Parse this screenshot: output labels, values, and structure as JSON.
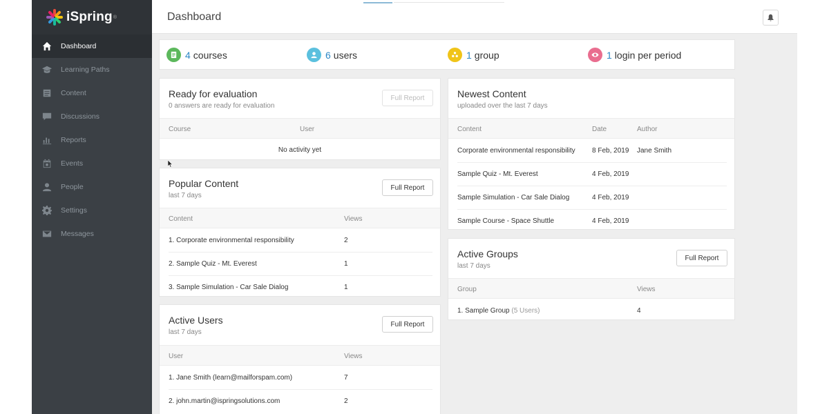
{
  "app": {
    "logo_text": "iSpring",
    "logo_tm": "®"
  },
  "sidebar": {
    "items": [
      {
        "label": "Dashboard",
        "icon": "home-icon",
        "active": true
      },
      {
        "label": "Learning Paths",
        "icon": "graduation-cap-icon"
      },
      {
        "label": "Content",
        "icon": "content-icon"
      },
      {
        "label": "Discussions",
        "icon": "chat-icon"
      },
      {
        "label": "Reports",
        "icon": "bar-chart-icon"
      },
      {
        "label": "Events",
        "icon": "calendar-icon"
      },
      {
        "label": "People",
        "icon": "person-icon"
      },
      {
        "label": "Settings",
        "icon": "gear-icon"
      },
      {
        "label": "Messages",
        "icon": "envelope-icon"
      }
    ]
  },
  "header": {
    "title": "Dashboard",
    "notification_icon": "bell-icon"
  },
  "stats": {
    "courses": {
      "count": "4",
      "label": "courses",
      "color": "#5cb85c",
      "icon": "document-icon"
    },
    "users": {
      "count": "6",
      "label": "users",
      "color": "#5bc0de",
      "icon": "user-icon"
    },
    "groups": {
      "count": "1",
      "label": "group",
      "color": "#f0c419",
      "icon": "group-icon"
    },
    "logins": {
      "count": "1",
      "label": "login per period",
      "color": "#e96d8f",
      "icon": "eye-icon"
    }
  },
  "ready_for_evaluation": {
    "title": "Ready for evaluation",
    "subtitle": "0 answers are ready for evaluation",
    "button": "Full Report",
    "columns": [
      "Course",
      "User"
    ],
    "empty": "No activity yet"
  },
  "popular_content": {
    "title": "Popular Content",
    "subtitle": "last 7 days",
    "button": "Full Report",
    "columns": [
      "Content",
      "Views"
    ],
    "rows": [
      {
        "name": "1. Corporate environmental responsibility",
        "views": "2"
      },
      {
        "name": "2. Sample Quiz - Mt. Everest",
        "views": "1"
      },
      {
        "name": "3. Sample Simulation - Car Sale Dialog",
        "views": "1"
      }
    ]
  },
  "active_users": {
    "title": "Active Users",
    "subtitle": "last 7 days",
    "button": "Full Report",
    "columns": [
      "User",
      "Views"
    ],
    "rows": [
      {
        "name": "1. Jane Smith (learn@mailforspam.com)",
        "views": "7"
      },
      {
        "name": "2. john.martin@ispringsolutions.com",
        "views": "2"
      }
    ]
  },
  "newest_content": {
    "title": "Newest Content",
    "subtitle": "uploaded over the last 7 days",
    "columns": [
      "Content",
      "Date",
      "Author"
    ],
    "rows": [
      {
        "name": "Corporate environmental responsibility",
        "date": "8 Feb, 2019",
        "author": "Jane Smith"
      },
      {
        "name": "Sample Quiz - Mt. Everest",
        "date": "4 Feb, 2019",
        "author": ""
      },
      {
        "name": "Sample Simulation - Car Sale Dialog",
        "date": "4 Feb, 2019",
        "author": ""
      },
      {
        "name": "Sample Course - Space Shuttle",
        "date": "4 Feb, 2019",
        "author": ""
      }
    ]
  },
  "active_groups": {
    "title": "Active Groups",
    "subtitle": "last 7 days",
    "button": "Full Report",
    "columns": [
      "Group",
      "Views"
    ],
    "rows": [
      {
        "name": "1. Sample Group",
        "count": "(5 Users)",
        "views": "4"
      }
    ]
  }
}
